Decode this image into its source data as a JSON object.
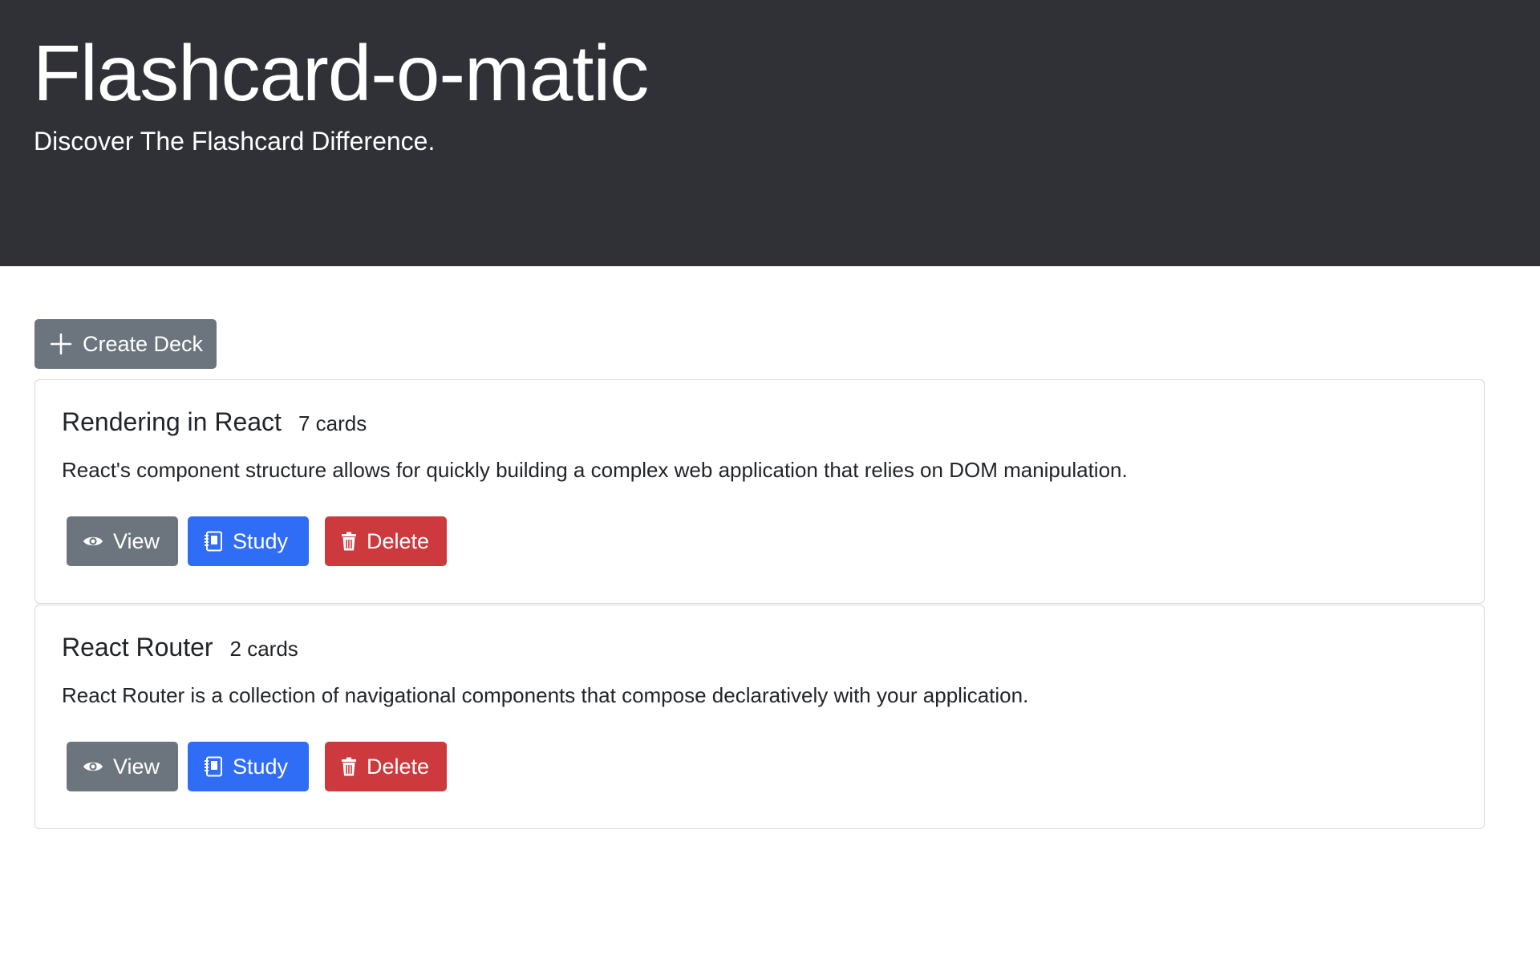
{
  "header": {
    "title": "Flashcard-o-matic",
    "subtitle": "Discover The Flashcard Difference."
  },
  "toolbar": {
    "create_deck_label": "Create Deck"
  },
  "decks": [
    {
      "name": "Rendering in React",
      "count": "7 cards",
      "description": "React's component structure allows for quickly building a complex web application that relies on DOM manipulation.",
      "view_label": "View",
      "study_label": "Study",
      "delete_label": "Delete"
    },
    {
      "name": "React Router",
      "count": "2 cards",
      "description": "React Router is a collection of navigational components that compose declaratively with your application.",
      "view_label": "View",
      "study_label": "Study",
      "delete_label": "Delete"
    }
  ],
  "icons": {
    "create": "plus-icon",
    "view": "eye-icon",
    "study": "journal-icon",
    "delete": "trash-icon"
  },
  "colors": {
    "header_bg": "#2f3136",
    "secondary": "#6c757d",
    "primary": "#2f6df6",
    "danger": "#cc3a3d"
  }
}
